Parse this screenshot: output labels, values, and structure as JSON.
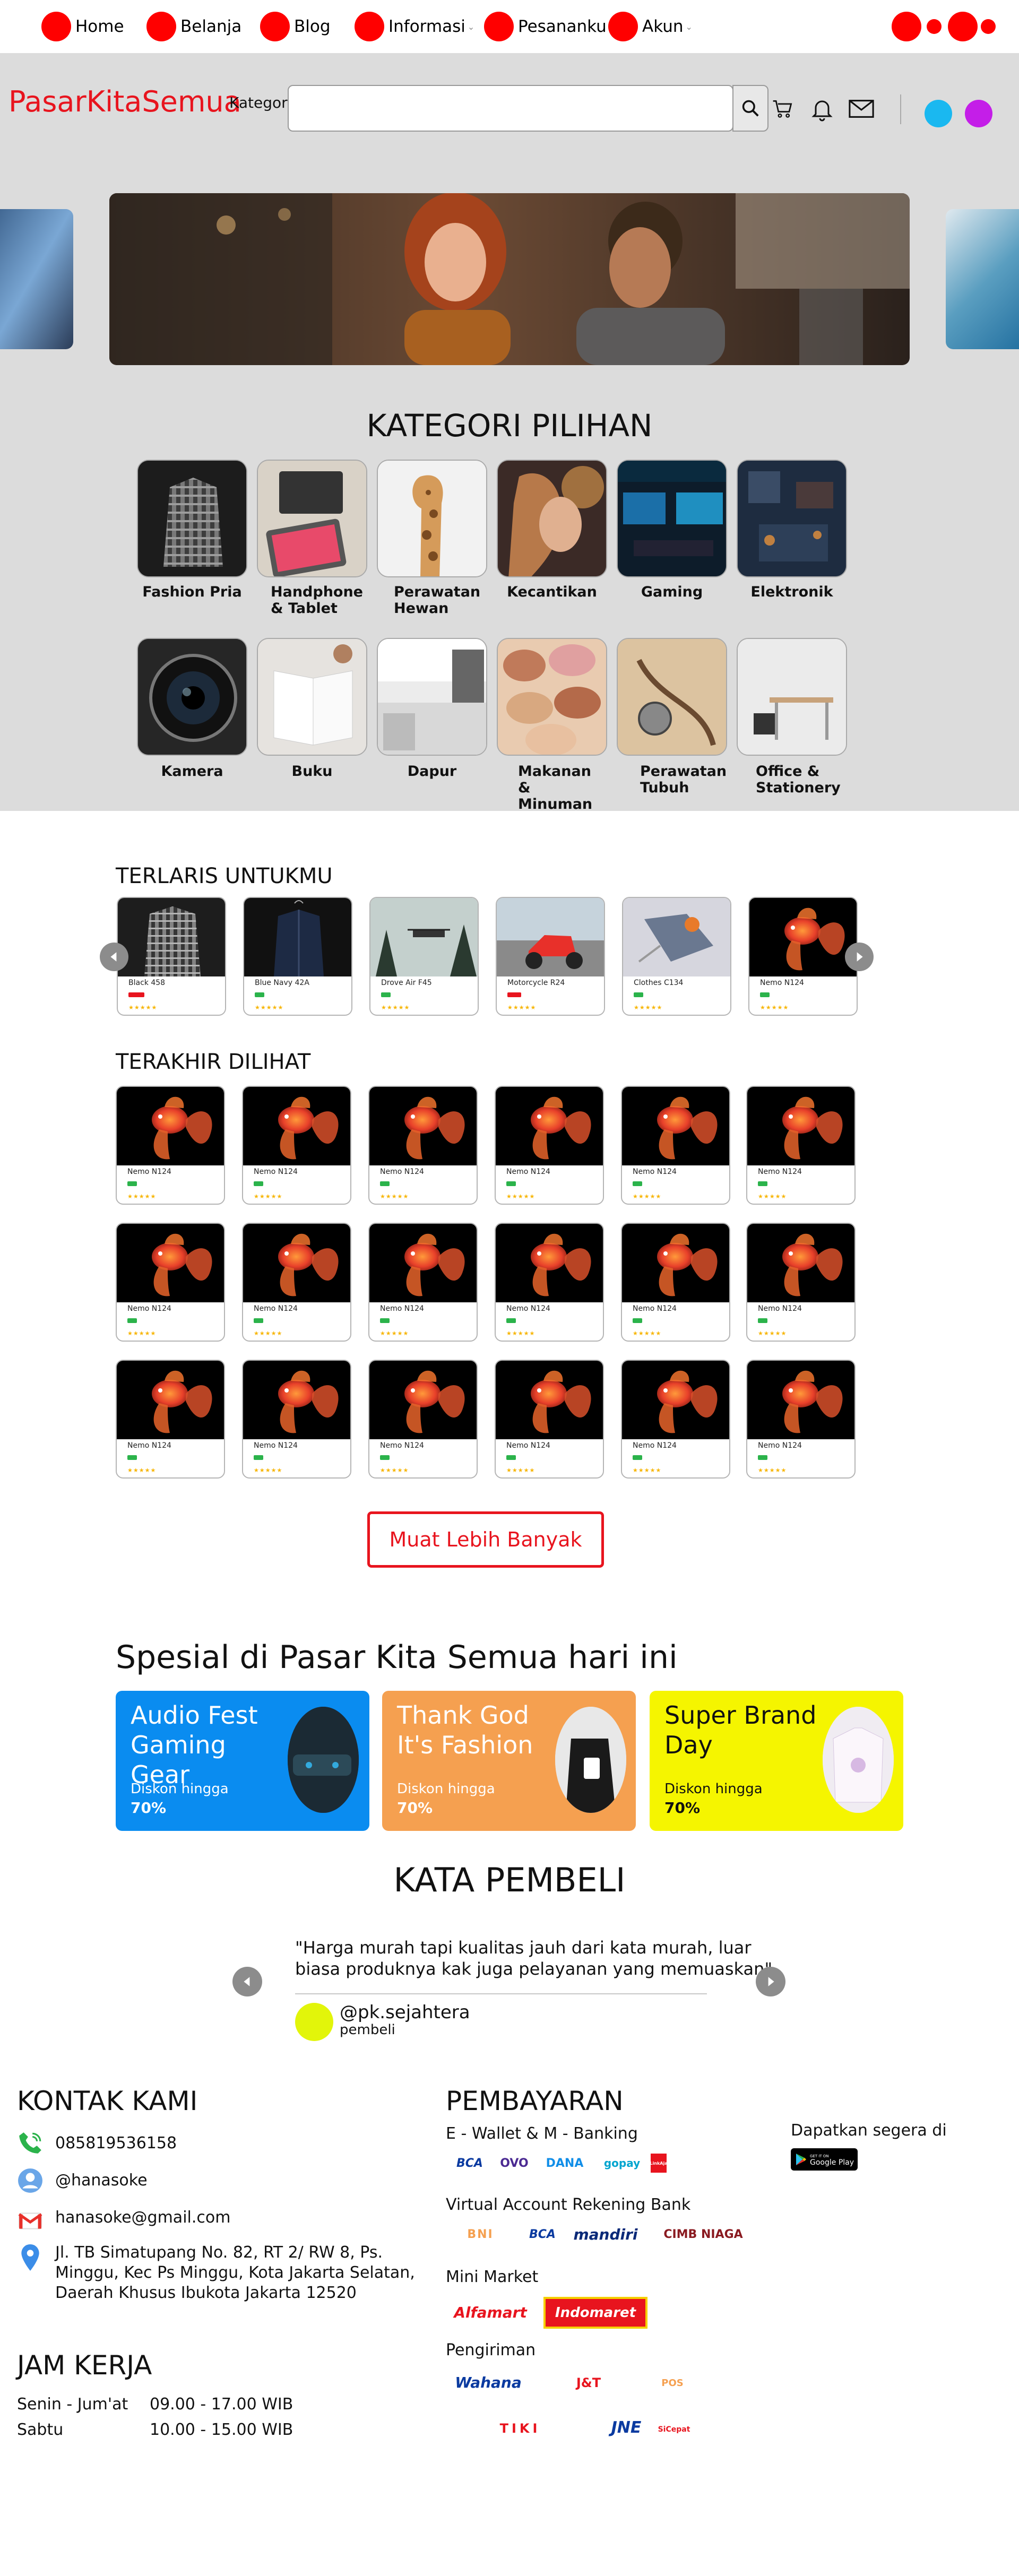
{
  "nav": {
    "items": [
      {
        "label": "Home"
      },
      {
        "label": "Belanja"
      },
      {
        "label": "Blog"
      },
      {
        "label": "Informasi"
      },
      {
        "label": "Pesananku"
      },
      {
        "label": "Akun"
      }
    ],
    "caret": "⌄"
  },
  "header": {
    "logo": "PasarKitaSemua",
    "category_label": "Kategori",
    "search_placeholder": "",
    "icons": [
      "search-icon",
      "cart-icon",
      "bell-icon",
      "mail-icon"
    ],
    "avatar_colors": [
      "#1ab8f0",
      "#c41ee8"
    ]
  },
  "categories": {
    "title": "KATEGORI PILIHAN",
    "items": [
      {
        "label": "Fashion Pria"
      },
      {
        "label": "Handphone & Tablet"
      },
      {
        "label": "Perawatan Hewan"
      },
      {
        "label": "Kecantikan"
      },
      {
        "label": "Gaming"
      },
      {
        "label": "Elektronik"
      },
      {
        "label": "Kamera"
      },
      {
        "label": "Buku"
      },
      {
        "label": "Dapur"
      },
      {
        "label": "Makanan & Minuman"
      },
      {
        "label": "Perawatan Tubuh"
      },
      {
        "label": "Office & Stationery"
      }
    ]
  },
  "bestseller": {
    "title": "TERLARIS UNTUKMU",
    "products": [
      {
        "name": "Black 458",
        "stars": "★★★★★"
      },
      {
        "name": "Blue Navy 42A",
        "stars": "★★★★★"
      },
      {
        "name": "Drove Air F45",
        "stars": "★★★★★"
      },
      {
        "name": "Motorcycle R24",
        "stars": "★★★★★"
      },
      {
        "name": "Clothes C134",
        "stars": "★★★★★"
      },
      {
        "name": "Nemo N124",
        "stars": "★★★★★"
      }
    ]
  },
  "recent": {
    "title": "TERAKHIR DILIHAT",
    "product_name": "Nemo N124",
    "stars": "★★★★★",
    "load_more": "Muat Lebih Banyak"
  },
  "special": {
    "title": "Spesial di Pasar Kita Semua hari ini",
    "promos": [
      {
        "title": "Audio Fest Gaming Gear",
        "sub": "Diskon hingga",
        "value": "70%",
        "color": "#0a8cf0"
      },
      {
        "title": "Thank God It's Fashion",
        "sub": "Diskon hingga",
        "value": "70%",
        "color": "#f5a050"
      },
      {
        "title": "Super Brand Day",
        "sub": "Diskon hingga",
        "value": "70%",
        "color": "#f5f500"
      }
    ]
  },
  "testimonial": {
    "title": "KATA PEMBELI",
    "quote": "\"Harga murah tapi kualitas jauh dari kata murah, luar biasa produknya kak juga pelayanan yang memuaskan\"",
    "user": "@pk.sejahtera",
    "role": "pembeli"
  },
  "footer": {
    "contact": {
      "title": "KONTAK KAMI",
      "phone": "085819536158",
      "social": "@hanasoke",
      "email": "hanasoke@gmail.com",
      "address": "Jl. TB Simatupang No. 82, RT 2/ RW 8, Ps. Minggu, Kec Ps Minggu, Kota Jakarta Selatan, Daerah Khusus Ibukota Jakarta 12520"
    },
    "hours": {
      "title": "JAM KERJA",
      "rows": [
        {
          "day": "Senin - Jum'at",
          "time": "09.00 - 17.00 WIB"
        },
        {
          "day": "Sabtu",
          "time": "10.00 - 15.00 WIB"
        }
      ]
    },
    "payment": {
      "title": "PEMBAYARAN",
      "wallet_label": "E - Wallet & M - Banking",
      "wallet_logos": [
        "BCA",
        "OVO",
        "DANA",
        "gopay",
        "LinkAja"
      ],
      "va_label": "Virtual Account Rekening Bank",
      "va_logos": [
        "BNI",
        "BCA",
        "mandiri",
        "CIMB NIAGA"
      ],
      "mini_label": "Mini Market",
      "mini_logos": [
        "Alfamart",
        "Indomaret"
      ],
      "ship_label": "Pengiriman",
      "ship_logos": [
        "Wahana",
        "J&T",
        "POS",
        "TIKI",
        "JNE",
        "SiCepat"
      ]
    },
    "app": {
      "label": "Dapatkan segera di",
      "store": "Google Play",
      "store_small": "GET IT ON"
    }
  }
}
